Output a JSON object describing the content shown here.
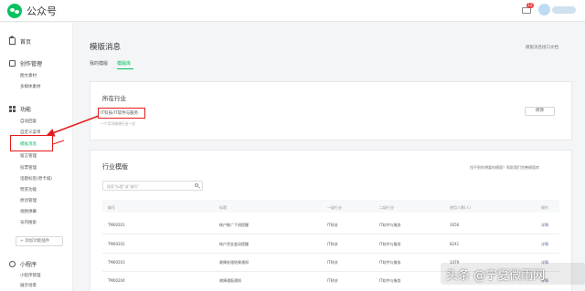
{
  "app": {
    "name": "公众号"
  },
  "header": {
    "mail_badge": "12"
  },
  "sidebar": {
    "home": "首页",
    "create_section": "创作管理",
    "create_items": [
      "图文素材",
      "多媒体素材"
    ],
    "func_section": "功能",
    "func_items": [
      "自动回复",
      "自定义菜单",
      "模板消息",
      "留言管理",
      "投票管理",
      "话题标签(原卡城)",
      "赞赏功能",
      "原创管理",
      "视频弹幕",
      "号内搜索"
    ],
    "add_plugin": "添加功能插件",
    "mini_section": "小程序",
    "mini_items": [
      "小程序管理",
      "展示场景"
    ]
  },
  "page": {
    "title": "模版消息",
    "doc_link": "模版消息接口文档",
    "tabs": [
      "我的模版",
      "模版库"
    ],
    "active_tab": "模版库"
  },
  "industry": {
    "title": "所在行业",
    "tag": "IT科技/IT软件与服务",
    "hint": "一个月可修改行业一次",
    "edit_button": "修改"
  },
  "library": {
    "title": "行业模版",
    "help_text": "找不到你想要的模版？帮助我们完善模版库",
    "search_placeholder": "搜索\"标题\"或\"编号\"",
    "columns": [
      "编号",
      "标题",
      "一级行业",
      "二级行业",
      "使用人数(人)",
      "操作"
    ],
    "rows": [
      [
        "TM00201",
        "帐户推广下线提醒",
        "IT科技",
        "IT软件与服务",
        "1656",
        "详情"
      ],
      [
        "TM00202",
        "帐户资金变动提醒",
        "IT科技",
        "IT软件与服务",
        "8241",
        "详情"
      ],
      [
        "TM00203",
        "故障处理结果通知",
        "IT科技",
        "IT软件与服务",
        "1479",
        "详情"
      ],
      [
        "TM00204",
        "故障通报通知",
        "IT科技",
        "IT软件与服务",
        "",
        "详情"
      ]
    ]
  },
  "watermark": "头条 @宁夏微雨网",
  "colors": {
    "accent": "#07c160",
    "annotation": "#e31b1b",
    "link": "#576b95"
  }
}
